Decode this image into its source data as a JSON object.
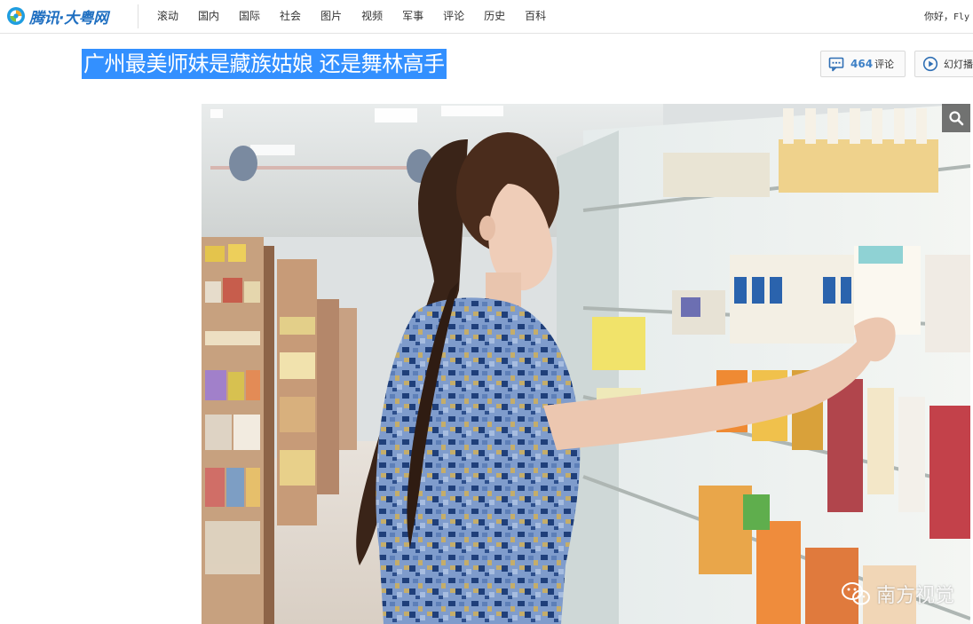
{
  "site": {
    "logo_text": "腾讯·大粤网",
    "colors": {
      "brand_blue": "#1f6fc1",
      "selection_blue": "#3390ff",
      "count_blue": "#3d80c6"
    }
  },
  "nav": {
    "items": [
      {
        "label": "滚动"
      },
      {
        "label": "国内"
      },
      {
        "label": "国际"
      },
      {
        "label": "社会"
      },
      {
        "label": "图片"
      },
      {
        "label": "视频"
      },
      {
        "label": "军事"
      },
      {
        "label": "评论"
      },
      {
        "label": "历史"
      },
      {
        "label": "百科"
      }
    ],
    "greeting": "你好，",
    "user": "Fly"
  },
  "article": {
    "title": "广州最美师妹是藏族姑娘 还是舞林高手",
    "comment_count": "464",
    "comment_label": "评论",
    "slideshow_label": "幻灯播放",
    "photo_watermark": "南方视觉",
    "icons": {
      "comment": "comment-bubble-icon",
      "slideshow": "play-circle-icon",
      "zoom": "magnifier-icon",
      "watermark": "wechat-icon"
    }
  }
}
